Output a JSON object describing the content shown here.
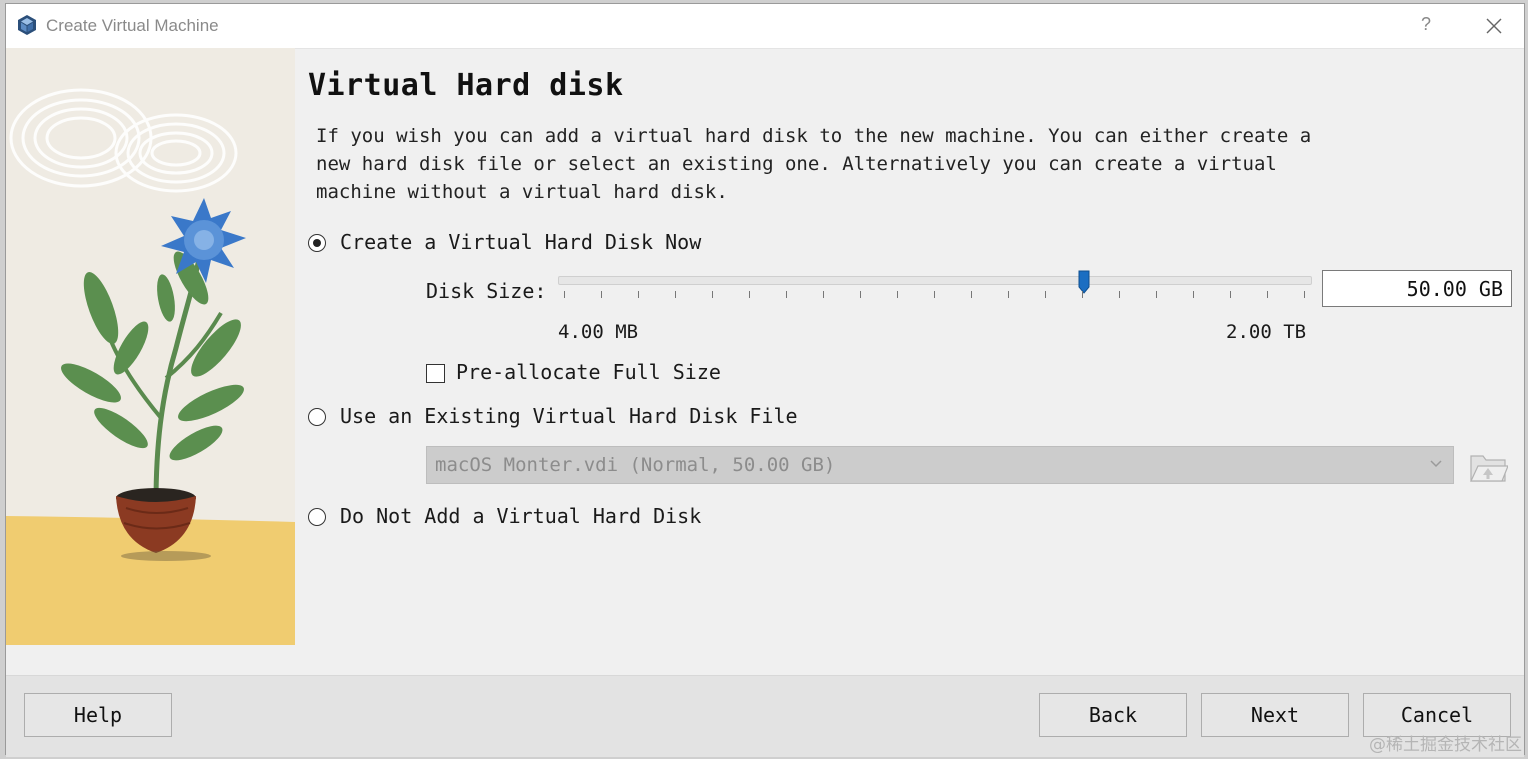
{
  "window": {
    "title": "Create Virtual Machine",
    "help_glyph": "?",
    "app_icon": "virtualbox-cube-icon",
    "close_icon": "close-icon"
  },
  "page": {
    "title": "Virtual Hard disk",
    "description": "If you wish you can add a virtual hard disk to the new machine. You can either create a\nnew hard disk file or select an existing one. Alternatively you can create a virtual\nmachine without a virtual hard disk."
  },
  "options": {
    "create_now": {
      "label": "Create a Virtual Hard Disk Now",
      "selected": true
    },
    "use_existing": {
      "label": "Use an Existing Virtual Hard Disk File",
      "selected": false
    },
    "none": {
      "label": "Do Not Add a Virtual Hard Disk",
      "selected": false
    }
  },
  "disk_size": {
    "label": "Disk Size:",
    "value": "50.00 GB",
    "slider_fraction": 0.7,
    "min_label": "4.00 MB",
    "max_label": "2.00 TB"
  },
  "preallocate": {
    "label": "Pre-allocate Full Size",
    "checked": false
  },
  "existing_file": {
    "value": "macOS Monter.vdi (Normal, 50.00 GB)",
    "enabled": false
  },
  "buttons": {
    "help": "Help",
    "back": "Back",
    "next": "Next",
    "cancel": "Cancel"
  },
  "watermark": "@稀土掘金技术社区",
  "colors": {
    "slider_handle": "#1b6ec2",
    "flower": "#3a78c9",
    "pot": "#8b3a22",
    "table": "#f0cc70"
  }
}
